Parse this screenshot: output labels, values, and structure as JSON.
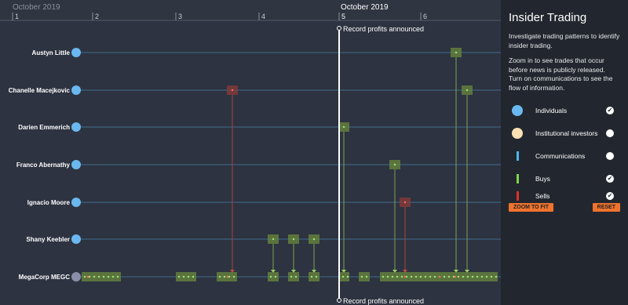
{
  "timeline": {
    "month_left": "October 2019",
    "month_center": "October 2019",
    "day_ticks": [
      "1",
      "2",
      "3",
      "4",
      "5",
      "6"
    ],
    "event_top": "Record profits announced",
    "event_bottom": "Record profits announced"
  },
  "people": [
    "Austyn Little",
    "Chanelle Macejkovic",
    "Darien Emmerich",
    "Franco Abernathy",
    "Ignacio Moore",
    "Shany Keebler",
    "MegaCorp MEGC"
  ],
  "panel": {
    "title": "Insider Trading",
    "desc1": "Investigate trading patterns to identify insider trading.",
    "desc2": "Zoom in to see trades that occur before news is publicly released. Turn on communications to see the flow of information.",
    "legend": [
      {
        "label": "Individuals",
        "checked": true,
        "color": "#6ab8f0",
        "shape": "circle"
      },
      {
        "label": "Institutional investors",
        "checked": false,
        "color": "#fbe0b4",
        "shape": "circle"
      },
      {
        "label": "Communications",
        "checked": false,
        "color": "#4fb6e8",
        "shape": "bar"
      },
      {
        "label": "Buys",
        "checked": true,
        "color": "#7fd34a",
        "shape": "bar"
      },
      {
        "label": "Sells",
        "checked": true,
        "color": "#e0302a",
        "shape": "bar"
      }
    ],
    "zoom_label": "ZOOM TO FIT",
    "reset_label": "RESET",
    "check_on": "✔",
    "check_off": ""
  },
  "colors": {
    "line": "#3e6d8e",
    "individual": "#6ab8f0",
    "company": "#8b8ea8",
    "buy": "#6a8a3c",
    "sell": "#8e3b38"
  }
}
